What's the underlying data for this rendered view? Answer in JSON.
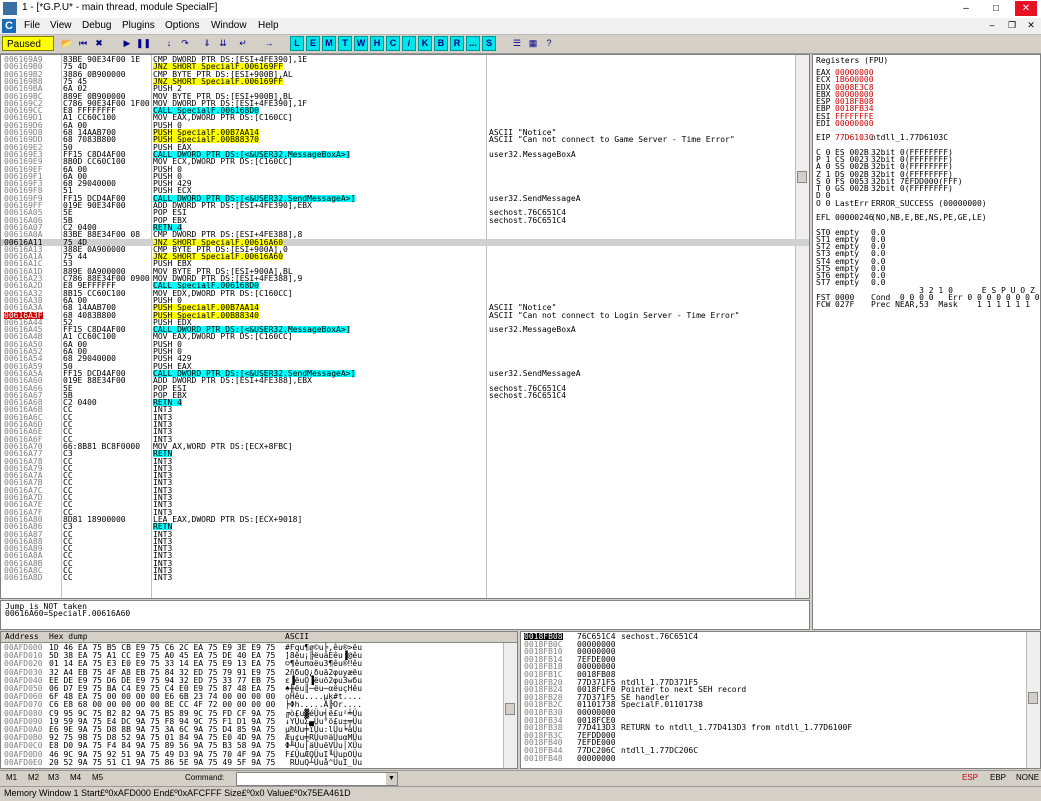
{
  "window": {
    "title": "1 - [*G.P.U* - main thread, module SpecialF]"
  },
  "menu": [
    "File",
    "View",
    "Debug",
    "Plugins",
    "Options",
    "Window",
    "Help"
  ],
  "toolbar": {
    "status": "Paused",
    "letters": [
      "L",
      "E",
      "M",
      "T",
      "W",
      "H",
      "C",
      "/",
      "K",
      "B",
      "R",
      "...",
      "S"
    ]
  },
  "disasm": [
    [
      "006169A9",
      "83BE 90E34F00 1E",
      "CMP DWORD PTR DS:[ESI+4FE390],1E",
      "",
      ""
    ],
    [
      "006169B0",
      "75 4D",
      "JNZ SHORT SpecialF.006169FF",
      "",
      "y"
    ],
    [
      "006169B2",
      "3886 0B900000",
      "CMP BYTE PTR DS:[ESI+900B],AL",
      "",
      ""
    ],
    [
      "006169B8",
      "75 45",
      "JNZ SHORT SpecialF.006169FF",
      "",
      "y"
    ],
    [
      "006169BA",
      "6A 02",
      "PUSH 2",
      "",
      ""
    ],
    [
      "006169BC",
      "889E 0B900000",
      "MOV BYTE PTR DS:[ESI+900B],BL",
      "",
      ""
    ],
    [
      "006169C2",
      "C786 90E34F00 1F00",
      "MOV DWORD PTR DS:[ESI+4FE390],1F",
      "",
      ""
    ],
    [
      "006169CC",
      "E8 FFFFFFFF",
      "CALL SpecialF.006168D0",
      "",
      "c"
    ],
    [
      "006169D1",
      "A1 CC60C100",
      "MOV EAX,DWORD PTR DS:[C160CC]",
      "",
      ""
    ],
    [
      "006169D6",
      "6A 00",
      "PUSH 0",
      "",
      ""
    ],
    [
      "006169D8",
      "68 14AAB700",
      "PUSH SpecialF.00B7AA14",
      "ASCII \"Notice\"",
      "y"
    ],
    [
      "006169DD",
      "68 7083B800",
      "PUSH SpecialF.00B88370",
      "ASCII \"Can not connect to Game Server - Time Error\"",
      "y"
    ],
    [
      "006169E2",
      "50",
      "PUSH EAX",
      "",
      ""
    ],
    [
      "006169E3",
      "FF15 C8D4AF00",
      "CALL DWORD PTR DS:[<&USER32.MessageBoxA>]",
      "user32.MessageBoxA",
      "c"
    ],
    [
      "006169E9",
      "8B0D CC60C100",
      "MOV ECX,DWORD PTR DS:[C160CC]",
      "",
      ""
    ],
    [
      "006169EF",
      "6A 00",
      "PUSH 0",
      "",
      ""
    ],
    [
      "006169F1",
      "6A 00",
      "PUSH 0",
      "",
      ""
    ],
    [
      "006169F3",
      "68 29040000",
      "PUSH 429",
      "",
      ""
    ],
    [
      "006169F8",
      "51",
      "PUSH ECX",
      "",
      ""
    ],
    [
      "006169F9",
      "FF15 DCD4AF00",
      "CALL DWORD PTR DS:[<&USER32.SendMessageA>]",
      "user32.SendMessageA",
      "c"
    ],
    [
      "006169FF",
      "019E 90E34F00",
      "ADD DWORD PTR DS:[ESI+4FE390],EBX",
      "",
      ""
    ],
    [
      "00616A05",
      "5E",
      "POP ESI",
      "sechost.76C651C4",
      ""
    ],
    [
      "00616A06",
      "5B",
      "POP EBX",
      "sechost.76C651C4",
      ""
    ],
    [
      "00616A07",
      "C2 0400",
      "RETN 4",
      "",
      "c"
    ],
    [
      "00616A0A",
      "83BE 88E34F00 08",
      "CMP DWORD PTR DS:[ESI+4FE388],8",
      "",
      ""
    ],
    [
      "00616A11",
      "75 4D",
      "JNZ SHORT SpecialF.00616A60",
      "",
      "ys"
    ],
    [
      "00616A13",
      "388E 0A900000",
      "CMP BYTE PTR DS:[ESI+900A],0",
      "",
      ""
    ],
    [
      "00616A1A",
      "75 44",
      "JNZ SHORT SpecialF.00616A60",
      "",
      "y"
    ],
    [
      "00616A1C",
      "53",
      "PUSH EBX",
      "",
      ""
    ],
    [
      "00616A1D",
      "889E 0A900000",
      "MOV BYTE PTR DS:[ESI+900A],BL",
      "",
      ""
    ],
    [
      "00616A23",
      "C786 88E34F00 0900",
      "MOV DWORD PTR DS:[ESI+4FE388],9",
      "",
      ""
    ],
    [
      "00616A2D",
      "E8 9EFFFFFF",
      "CALL SpecialF.006168D0",
      "",
      "c"
    ],
    [
      "00616A32",
      "8B15 CC60C100",
      "MOV EDX,DWORD PTR DS:[C160CC]",
      "",
      ""
    ],
    [
      "00616A38",
      "6A 00",
      "PUSH 0",
      "",
      ""
    ],
    [
      "00616A3A",
      "68 14AAB700",
      "PUSH SpecialF.00B7AA14",
      "ASCII \"Notice\"",
      "y"
    ],
    [
      "00616A3F",
      "68 4083B800",
      "PUSH SpecialF.00B88340",
      "ASCII \"Can not connect to Login Server - Time Error\"",
      "y"
    ],
    [
      "00616A44",
      "52",
      "PUSH EDX",
      "",
      ""
    ],
    [
      "00616A45",
      "FF15 C8D4AF00",
      "CALL DWORD PTR DS:[<&USER32.MessageBoxA>]",
      "user32.MessageBoxA",
      "c"
    ],
    [
      "00616A4B",
      "A1 CC60C100",
      "MOV EAX,DWORD PTR DS:[C160CC]",
      "",
      ""
    ],
    [
      "00616A50",
      "6A 00",
      "PUSH 0",
      "",
      ""
    ],
    [
      "00616A52",
      "6A 00",
      "PUSH 0",
      "",
      ""
    ],
    [
      "00616A54",
      "68 29040000",
      "PUSH 429",
      "",
      ""
    ],
    [
      "00616A59",
      "50",
      "PUSH EAX",
      "",
      ""
    ],
    [
      "00616A5A",
      "FF15 DCD4AF00",
      "CALL DWORD PTR DS:[<&USER32.SendMessageA>]",
      "user32.SendMessageA",
      "c"
    ],
    [
      "00616A60",
      "019E 88E34F00",
      "ADD DWORD PTR DS:[ESI+4FE388],EBX",
      "",
      ""
    ],
    [
      "00616A66",
      "5E",
      "POP ESI",
      "sechost.76C651C4",
      ""
    ],
    [
      "00616A67",
      "5B",
      "POP EBX",
      "sechost.76C651C4",
      ""
    ],
    [
      "00616A68",
      "C2 0400",
      "RETN 4",
      "",
      "c"
    ],
    [
      "00616A6B",
      "CC",
      "INT3",
      "",
      ""
    ],
    [
      "00616A6C",
      "CC",
      "INT3",
      "",
      ""
    ],
    [
      "00616A6D",
      "CC",
      "INT3",
      "",
      ""
    ],
    [
      "00616A6E",
      "CC",
      "INT3",
      "",
      ""
    ],
    [
      "00616A6F",
      "CC",
      "INT3",
      "",
      ""
    ],
    [
      "00616A70",
      "66:8B81 BC8F0000",
      "MOV AX,WORD PTR DS:[ECX+8FBC]",
      "",
      ""
    ],
    [
      "00616A77",
      "C3",
      "RETN",
      "",
      "c"
    ],
    [
      "00616A78",
      "CC",
      "INT3",
      "",
      ""
    ],
    [
      "00616A79",
      "CC",
      "INT3",
      "",
      ""
    ],
    [
      "00616A7A",
      "CC",
      "INT3",
      "",
      ""
    ],
    [
      "00616A7B",
      "CC",
      "INT3",
      "",
      ""
    ],
    [
      "00616A7C",
      "CC",
      "INT3",
      "",
      ""
    ],
    [
      "00616A7D",
      "CC",
      "INT3",
      "",
      ""
    ],
    [
      "00616A7E",
      "CC",
      "INT3",
      "",
      ""
    ],
    [
      "00616A7F",
      "CC",
      "INT3",
      "",
      ""
    ],
    [
      "00616A80",
      "8D81 18900000",
      "LEA EAX,DWORD PTR DS:[ECX+9018]",
      "",
      ""
    ],
    [
      "00616A86",
      "C3",
      "RETN",
      "",
      "c"
    ],
    [
      "00616A87",
      "CC",
      "INT3",
      "",
      ""
    ],
    [
      "00616A88",
      "CC",
      "INT3",
      "",
      ""
    ],
    [
      "00616A89",
      "CC",
      "INT3",
      "",
      ""
    ],
    [
      "00616A8A",
      "CC",
      "INT3",
      "",
      ""
    ],
    [
      "00616A8B",
      "CC",
      "INT3",
      "",
      ""
    ],
    [
      "00616A8C",
      "CC",
      "INT3",
      "",
      ""
    ],
    [
      "00616A8D",
      "CC",
      "INT3",
      "",
      ""
    ]
  ],
  "info": [
    "Jump is NOT taken",
    "00616A60=SpecialF.00616A60"
  ],
  "registers": {
    "header": "Registers (FPU)",
    "lines": [
      [
        "EAX",
        "00000000",
        ""
      ],
      [
        "ECX",
        "1B600000",
        ""
      ],
      [
        "EDX",
        "0008E3C8",
        ""
      ],
      [
        "EBX",
        "00000000",
        ""
      ],
      [
        "ESP",
        "0018FB08",
        ""
      ],
      [
        "EBP",
        "0018FB34",
        ""
      ],
      [
        "ESI",
        "FFFFFFFE",
        ""
      ],
      [
        "EDI",
        "00000000",
        ""
      ],
      [
        "",
        "",
        " "
      ],
      [
        "EIP",
        "77D6103C",
        "ntdll_1.77D6103C"
      ],
      [
        "",
        "",
        " "
      ],
      [
        "C 0",
        "ES 002B",
        "32bit 0(FFFFFFFF)"
      ],
      [
        "P 1",
        "CS 0023",
        "32bit 0(FFFFFFFF)"
      ],
      [
        "A 0",
        "SS 002B",
        "32bit 0(FFFFFFFF)"
      ],
      [
        "Z 1",
        "DS 002B",
        "32bit 0(FFFFFFFF)"
      ],
      [
        "S 0",
        "FS 0053",
        "32bit 7EFDD000(FFF)"
      ],
      [
        "T 0",
        "GS 002B",
        "32bit 0(FFFFFFFF)"
      ],
      [
        "D 0",
        "",
        ""
      ],
      [
        "O 0",
        "LastErr",
        "ERROR_SUCCESS (00000000)"
      ],
      [
        "",
        "",
        " "
      ],
      [
        "EFL",
        "00000246",
        "(NO,NB,E,BE,NS,PE,GE,LE)"
      ],
      [
        "",
        "",
        " "
      ],
      [
        "ST0",
        "empty",
        "0.0"
      ],
      [
        "ST1",
        "empty",
        "0.0"
      ],
      [
        "ST2",
        "empty",
        "0.0"
      ],
      [
        "ST3",
        "empty",
        "0.0"
      ],
      [
        "ST4",
        "empty",
        "0.0"
      ],
      [
        "ST5",
        "empty",
        "0.0"
      ],
      [
        "ST6",
        "empty",
        "0.0"
      ],
      [
        "ST7",
        "empty",
        "0.0"
      ],
      [
        "",
        "",
        "          3 2 1 0      E S P U O Z D I"
      ],
      [
        "FST",
        "0000",
        "Cond  0 0 0 0   Err 0 0 0 0 0 0 0 0"
      ],
      [
        "FCW",
        "027F",
        "Prec NEAR,53  Mask    1 1 1 1 1 1"
      ]
    ]
  },
  "dump": {
    "headers": [
      "Address",
      "Hex dump",
      "ASCII"
    ],
    "rows": [
      [
        "00AFD000",
        "1D 46 EA 75 B5 CB E9 75 C6 2C EA 75 E9 3E E9 75",
        "#Fqu¶ø©u╞,êu®>ëu"
      ],
      [
        "00AFD010",
        "5D 38 EA 75 A1 CC E9 75 A0 45 EA 75 DE 40 EA 75",
        "]8êu¡╠ëuáEêu▐@êu"
      ],
      [
        "00AFD020",
        "01 14 EA 75 E3 E0 E9 75 33 14 EA 75 E9 13 EA 75",
        "☺¶êuπαëu3¶êu®‼êu"
      ],
      [
        "00AFD030",
        "32 A4 EB 75 4F A8 EB 75 84 32 ED 75 79 91 E9 75",
        "2ñδuO¿δuä2φuyæëu"
      ],
      [
        "00AFD040",
        "EE DE E9 75 D6 DE E9 75 94 32 ED 75 33 77 EB 75",
        "ε▐ëuÖ▐ëuö2φu3wδu"
      ],
      [
        "00AFD050",
        "06 D7 E9 75 BA C4 E9 75 C4 E0 E9 75 87 48 EA 75",
        "♠╫ëu║─ëu─αëuçHêu"
      ],
      [
        "00AFD060",
        "6F 48 EA 75 00 00 00 00 E6 6B 23 74 00 00 00 00",
        "oHêu....µk#t...."
      ],
      [
        "00AFD070",
        "C6 E8 68 00 00 00 00 00 8E CC 4F 72 00 00 00 00",
        "╞Φh.....Ä╠Or...."
      ],
      [
        "00AFD080",
        "C9 95 9C 75 B2 82 9A 75 B5 89 9C 75 FD CF 9A 75",
        "╔ò£u▓éÜu╡ë£u²╧Üu"
      ],
      [
        "00AFD090",
        "19 59 9A 75 E4 DC 9A 75 F8 94 9C 75 F1 D1 9A 75",
        "↓YÜuΣ▄Üu°ö£u±╤Üu"
      ],
      [
        "00AFD0A0",
        "E6 9E 9A 75 D8 8B 9A 75 3A 6C 9A 75 D4 85 9A 75",
        "µ₧Üu╪ïÜu:lÜu╘àÜu"
      ],
      [
        "00AFD0B0",
        "92 75 9B 75 D8 52 9A 75 01 84 9A 75 E0 4D 9A 75",
        "Æu¢u╪RÜu☺äÜuαMÜu"
      ],
      [
        "00AFD0C0",
        "E8 D0 9A 75 F4 84 9A 75 89 56 9A 75 B3 58 9A 75",
        "Φ╨Üu⌠äÜuëVÜu│XÜu"
      ],
      [
        "00AFD0D0",
        "46 9C 9A 75 92 51 9A 75 49 D3 9A 75 70 4F 9A 75",
        "F£ÜuÆQÜuI╙ÜupOÜu"
      ],
      [
        "00AFD0E0",
        "20 52 9A 75 51 C1 9A 75 86 5E 9A 75 49 5F 9A 75",
        " RÜuQ┴Üuå^ÜuI_Üu"
      ]
    ]
  },
  "stack": [
    [
      "0018FB08",
      "76C651C4",
      "sechost.76C651C4"
    ],
    [
      "0018FB0C",
      "00000000",
      ""
    ],
    [
      "0018FB10",
      "00000000",
      ""
    ],
    [
      "0018FB14",
      "7EFDE000",
      ""
    ],
    [
      "0018FB18",
      "00000000",
      ""
    ],
    [
      "0018FB1C",
      "0018FB08",
      ""
    ],
    [
      "0018FB20",
      "77D371F5",
      "ntdll_1.77D371F5"
    ],
    [
      "0018FB24",
      "0018FCF0",
      "Pointer to next SEH record"
    ],
    [
      "0018FB28",
      "77D371F5",
      "SE handler"
    ],
    [
      "0018FB2C",
      "01101738",
      "SpecialF.01101738"
    ],
    [
      "0018FB30",
      "00000000",
      ""
    ],
    [
      "0018FB34",
      "0018FCE0",
      ""
    ],
    [
      "0018FB38",
      "77D413D3",
      "RETURN to ntdll_1.77D413D3 from ntdll_1.77D6100F"
    ],
    [
      "0018FB3C",
      "7EFDD000",
      ""
    ],
    [
      "0018FB40",
      "7EFDE000",
      ""
    ],
    [
      "0018FB44",
      "77DC206C",
      "ntdll_1.77DC206C"
    ],
    [
      "0018FB48",
      "00000000",
      ""
    ]
  ],
  "cmdbar": {
    "tabs": [
      "M1",
      "M2",
      "M3",
      "M4",
      "M5"
    ],
    "command_label": "Command:",
    "right": [
      "ESP",
      "EBP",
      "NONE"
    ]
  },
  "status": "Memory Window 1  Start£º0xAFD000  End£º0xAFCFFF  Size£º0x0 Value£º0x75EA461D"
}
